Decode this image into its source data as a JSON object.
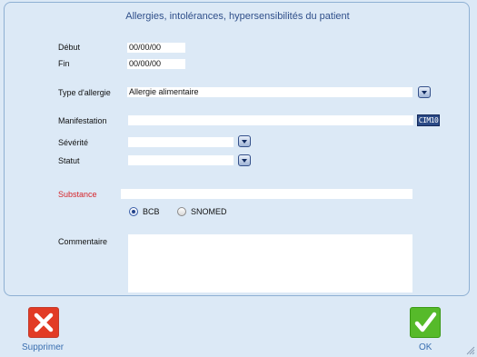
{
  "dialog": {
    "title": "Allergies, intolérances, hypersensibilités  du patient"
  },
  "form": {
    "debut_label": "Début",
    "debut_value": "00/00/00",
    "fin_label": "Fin",
    "fin_value": "00/00/00",
    "type_label": "Type d'allergie",
    "type_value": "Allergie alimentaire",
    "manifestation_label": "Manifestation",
    "manifestation_value": "",
    "cim10_label": "CIM10",
    "severite_label": "Sévérité",
    "severite_value": "",
    "statut_label": "Statut",
    "statut_value": "",
    "substance_label": "Substance",
    "substance_value": "",
    "radio_bcb_label": "BCB",
    "radio_snomed_label": "SNOMED",
    "radio_selected": "BCB",
    "commentaire_label": "Commentaire",
    "commentaire_value": ""
  },
  "footer": {
    "delete_label": "Supprimer",
    "ok_label": "OK"
  },
  "icons": {
    "dropdown": "chevron-down-icon",
    "delete": "close-icon",
    "ok": "checkmark-icon",
    "resize": "resize-grip-icon"
  },
  "colors": {
    "background": "#dce9f6",
    "title": "#2f4f8a",
    "required_label": "#d6242a",
    "delete_button": "#e23b25",
    "ok_button": "#56ba2a",
    "caption": "#3a6fb0"
  }
}
